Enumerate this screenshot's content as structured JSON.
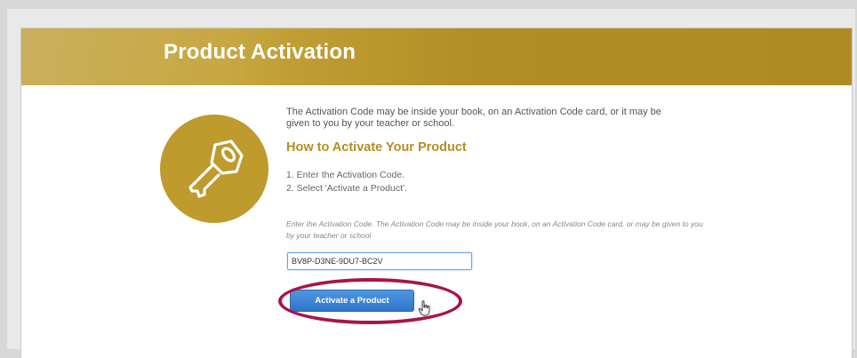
{
  "header": {
    "title": "Product Activation"
  },
  "intro_text": "The Activation Code may be inside your book, on an Activation Code card, or it may be given to you by your teacher or school.",
  "howto_heading": "How to Activate Your Product",
  "steps": [
    "1.  Enter the Activation Code.",
    "2.  Select 'Activate a Product'."
  ],
  "instructions": "Enter the Activation Code. The Activation Code may be inside your book, on an Activation Code card, or may be given to you by your teacher or school",
  "activation_input": {
    "value": "BV8P-D3NE-9DU7-BC2V"
  },
  "activate_button": {
    "label": "Activate a Product"
  },
  "icons": {
    "key": "key-icon",
    "cursor": "hand-pointer-icon"
  },
  "colors": {
    "banner": "#b8952e",
    "accent": "#b58d22",
    "button": "#3d85d6",
    "highlight": "#a8144a"
  }
}
